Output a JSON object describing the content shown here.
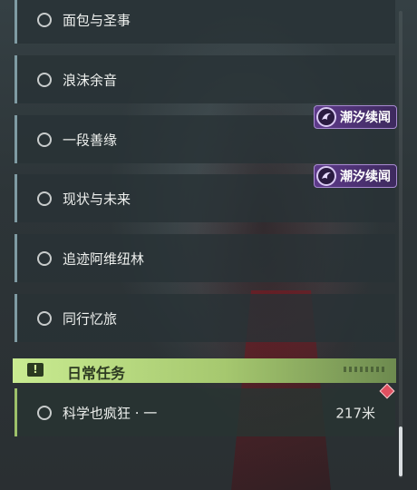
{
  "quests": [
    {
      "label": "面包与圣事"
    },
    {
      "label": "浪沫余音"
    },
    {
      "label": "一段善缘"
    },
    {
      "label": "现状与未来"
    },
    {
      "label": "追迹阿维纽林"
    },
    {
      "label": "同行忆旅"
    }
  ],
  "badges": [
    {
      "label": "潮汐续闻",
      "icon": "tide-icon"
    },
    {
      "label": "潮汐续闻",
      "icon": "tide-icon"
    }
  ],
  "daily_section": {
    "title": "日常任务",
    "icon": "exclamation-icon",
    "quests": [
      {
        "label": "科学也疯狂 · 一",
        "distance": "217米"
      }
    ]
  },
  "colors": {
    "daily_accent": "#c9eb91",
    "badge_purple": "#5e3a8a",
    "track_marker": "#e05060"
  },
  "scroll": {
    "position": 0.92
  }
}
